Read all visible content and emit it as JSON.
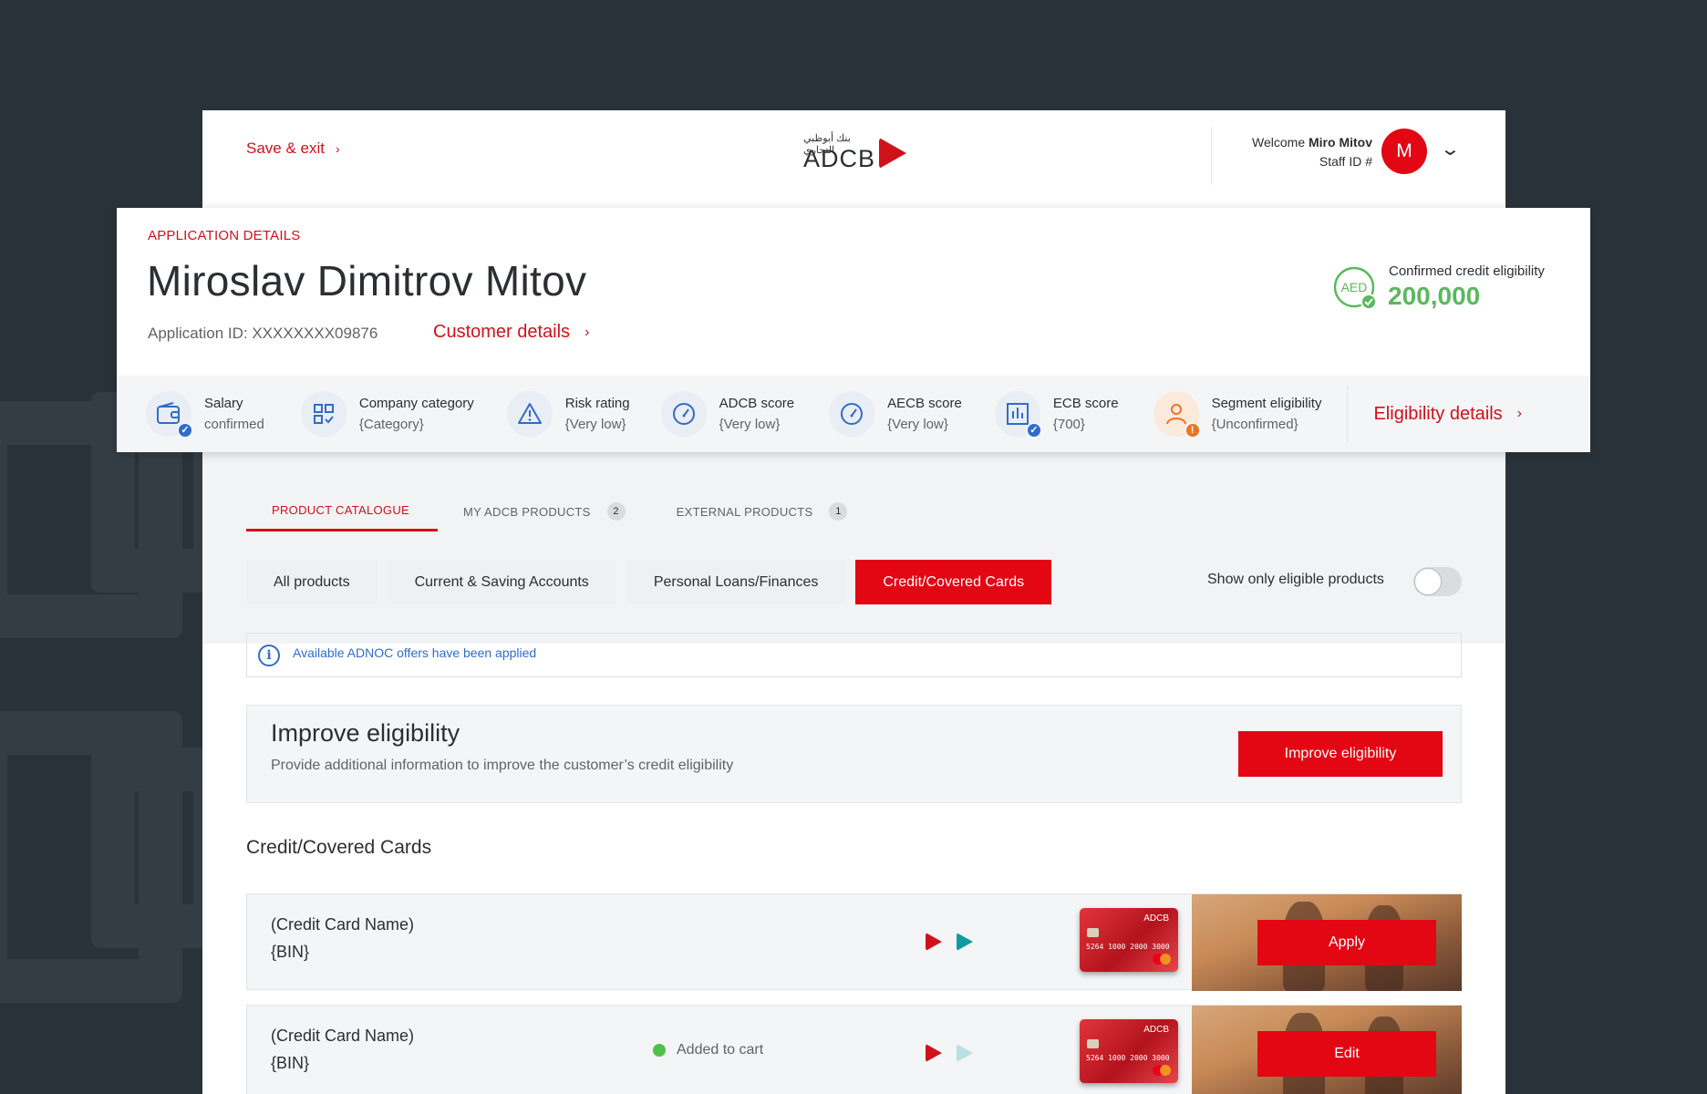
{
  "header": {
    "save_exit": "Save & exit",
    "logo_arabic": "بنك أبوظبي التجاري",
    "logo_text": "ADCB",
    "welcome_prefix": "Welcome",
    "user_name": "Miro Mitov",
    "staff_id": "Staff ID #",
    "avatar_initial": "M"
  },
  "application": {
    "label": "APPLICATION DETAILS",
    "customer_name": "Miroslav Dimitrov Mitov",
    "application_id": "Application ID: XXXXXXXX09876",
    "customer_details_link": "Customer details",
    "currency_badge": "AED",
    "credit_label": "Confirmed credit eligibility",
    "credit_value": "200,000"
  },
  "metrics": [
    {
      "label": "Salary",
      "value": "confirmed",
      "icon": "wallet-icon",
      "badge": "check"
    },
    {
      "label": "Company category",
      "value": "{Category}",
      "icon": "grid-icon",
      "badge": ""
    },
    {
      "label": "Risk rating",
      "value": "{Very low}",
      "icon": "warning-icon",
      "badge": ""
    },
    {
      "label": "ADCB score",
      "value": "{Very low}",
      "icon": "gauge-icon",
      "badge": ""
    },
    {
      "label": "AECB score",
      "value": "{Very low}",
      "icon": "gauge-icon",
      "badge": ""
    },
    {
      "label": "ECB score",
      "value": "{700}",
      "icon": "bar-chart-icon",
      "badge": "check"
    },
    {
      "label": "Segment eligibility",
      "value": "{Unconfirmed}",
      "icon": "user-icon",
      "badge": "alert"
    }
  ],
  "eligibility_link": "Eligibility details",
  "tabs": [
    {
      "label": "PRODUCT CATALOGUE",
      "count": ""
    },
    {
      "label": "MY ADCB PRODUCTS",
      "count": "2"
    },
    {
      "label": "EXTERNAL PRODUCTS",
      "count": "1"
    }
  ],
  "filters": [
    "All products",
    "Current & Saving Accounts",
    "Personal Loans/Finances",
    "Credit/Covered Cards"
  ],
  "toggle_label": "Show only eligible products",
  "info_text": "Available ADNOC offers have been applied",
  "improve": {
    "title": "Improve eligibility",
    "description": "Provide additional information to improve the customer’s credit eligibility",
    "button": "Improve eligibility"
  },
  "section_title": "Credit/Covered Cards",
  "cards": [
    {
      "name": "(Credit Card Name)",
      "bin": "{BIN}",
      "status": "",
      "action": "Apply",
      "card_brand": "ADCB",
      "card_number": "5264  1000  2000  3000"
    },
    {
      "name": "(Credit Card Name)",
      "bin": "{BIN}",
      "status": "Added to cart",
      "action": "Edit",
      "card_brand": "ADCB",
      "card_number": "5264  1000  2000  3000"
    }
  ],
  "colors": {
    "brand_red": "#e30613",
    "link_red": "#d0111b",
    "success_green": "#5ab85e",
    "info_blue": "#2f6dc9",
    "teal": "#139aa0"
  }
}
